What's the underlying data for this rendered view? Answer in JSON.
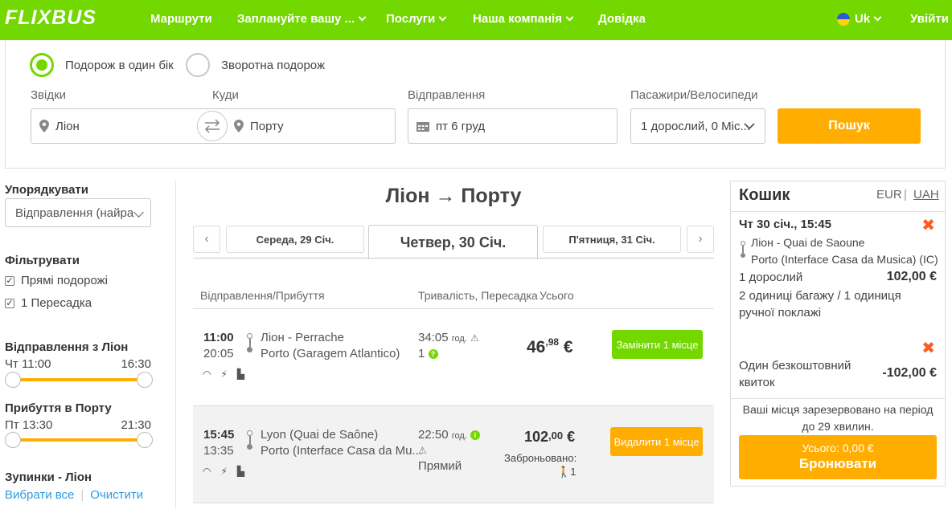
{
  "header": {
    "logo": "FLIXBUS",
    "nav": [
      "Маршрути",
      "Заплануйте вашу ...",
      "Послуги",
      "Наша компанія",
      "Довідка"
    ],
    "language": "Uk",
    "login": "Увійти"
  },
  "search": {
    "trip_one_way": "Подорож в один бік",
    "trip_return": "Зворотна подорож",
    "from_label": "Звідки",
    "from_value": "Ліон",
    "to_label": "Куди",
    "to_value": "Порту",
    "date_label": "Відправлення",
    "date_value": "пт 6 груд",
    "passengers_label": "Пасажири/Велосипеди",
    "passengers_value": "1 дорослий, 0 Міс...",
    "search_button": "Пошук"
  },
  "sidebar": {
    "sort_heading": "Упорядкувати",
    "sort_value": "Відправлення (найра",
    "filter_heading": "Фільтрувати",
    "filters": [
      "Прямі подорожі",
      "1 Пересадка"
    ],
    "departure_heading": "Відправлення з Ліон",
    "departure_from": "Чт 11:00",
    "departure_to": "16:30",
    "arrival_heading": "Прибуття в Порту",
    "arrival_from": "Пт 13:30",
    "arrival_to": "21:30",
    "stops_heading": "Зупинки - Ліон",
    "select_all": "Вибрати все",
    "clear": "Очистити"
  },
  "results": {
    "route_title": "Ліон → Порту",
    "prev_day": "Середа, 29 Січ.",
    "current_day": "Четвер, 30 Січ.",
    "next_day": "П'ятниця, 31 Січ.",
    "col_times": "Відправлення/Прибуття",
    "col_duration": "Тривалість, Пересадка",
    "col_total": "Усього",
    "rows": [
      {
        "dep_time": "11:00",
        "arr_time": "20:05",
        "dep_station": "Ліон - Perrache",
        "arr_station": "Porto (Garagem Atlantico)",
        "duration": "34:05",
        "duration_unit": "год.",
        "transfers": "1",
        "price_main": "46",
        "price_cents": ",98",
        "price_cur": "€",
        "action": "Замінити 1 місце"
      },
      {
        "dep_time": "15:45",
        "arr_time": "13:35",
        "dep_station": "Lyon (Quai de Saône)",
        "arr_station": "Porto (Interface Casa da Mu...",
        "duration": "22:50",
        "duration_unit": "год.",
        "transfers": "Прямий",
        "price_main": "102",
        "price_cents": ",00",
        "price_cur": "€",
        "booked_label": "Заброньовано:",
        "booked_count": "1",
        "action": "Видалити 1 місце"
      }
    ]
  },
  "cart": {
    "title": "Кошик",
    "currency_eur": "EUR",
    "currency_sep": "|",
    "currency_uah": "UAH",
    "trip_datetime": "Чт 30 січ., 15:45",
    "from_stop": "Ліон - Quai de Saoune",
    "to_stop": "Porto (Interface Casa da Musica) (IC)",
    "passenger": "1 дорослий",
    "passenger_price": "102,00 €",
    "luggage": "2 одиниці багажу / 1 одиниця ручної поклажі",
    "voucher": "Один безкоштовний квиток",
    "voucher_price": "-102,00 €",
    "reserved_note": "Ваші місця зарезервовано на період до 29 хвилин.",
    "total": "Усього: 0,00 €",
    "book_button": "Бронювати"
  },
  "colors": {
    "brand_green": "#73d700",
    "accent_orange": "#ffad00",
    "remove_red": "#ff5a1f"
  }
}
